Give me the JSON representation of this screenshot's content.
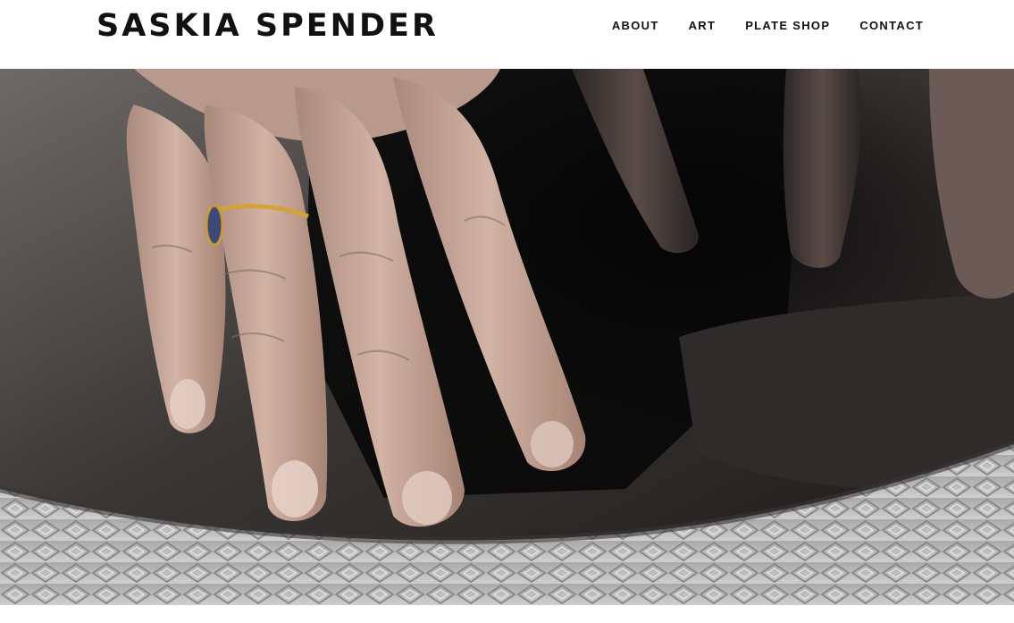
{
  "site": {
    "title": "SASKIA SPENDER"
  },
  "nav": {
    "items": [
      "ABOUT",
      "ART",
      "PLATE SHOP",
      "CONTACT"
    ]
  },
  "hero": {
    "image": "hands-on-clay-photo"
  }
}
